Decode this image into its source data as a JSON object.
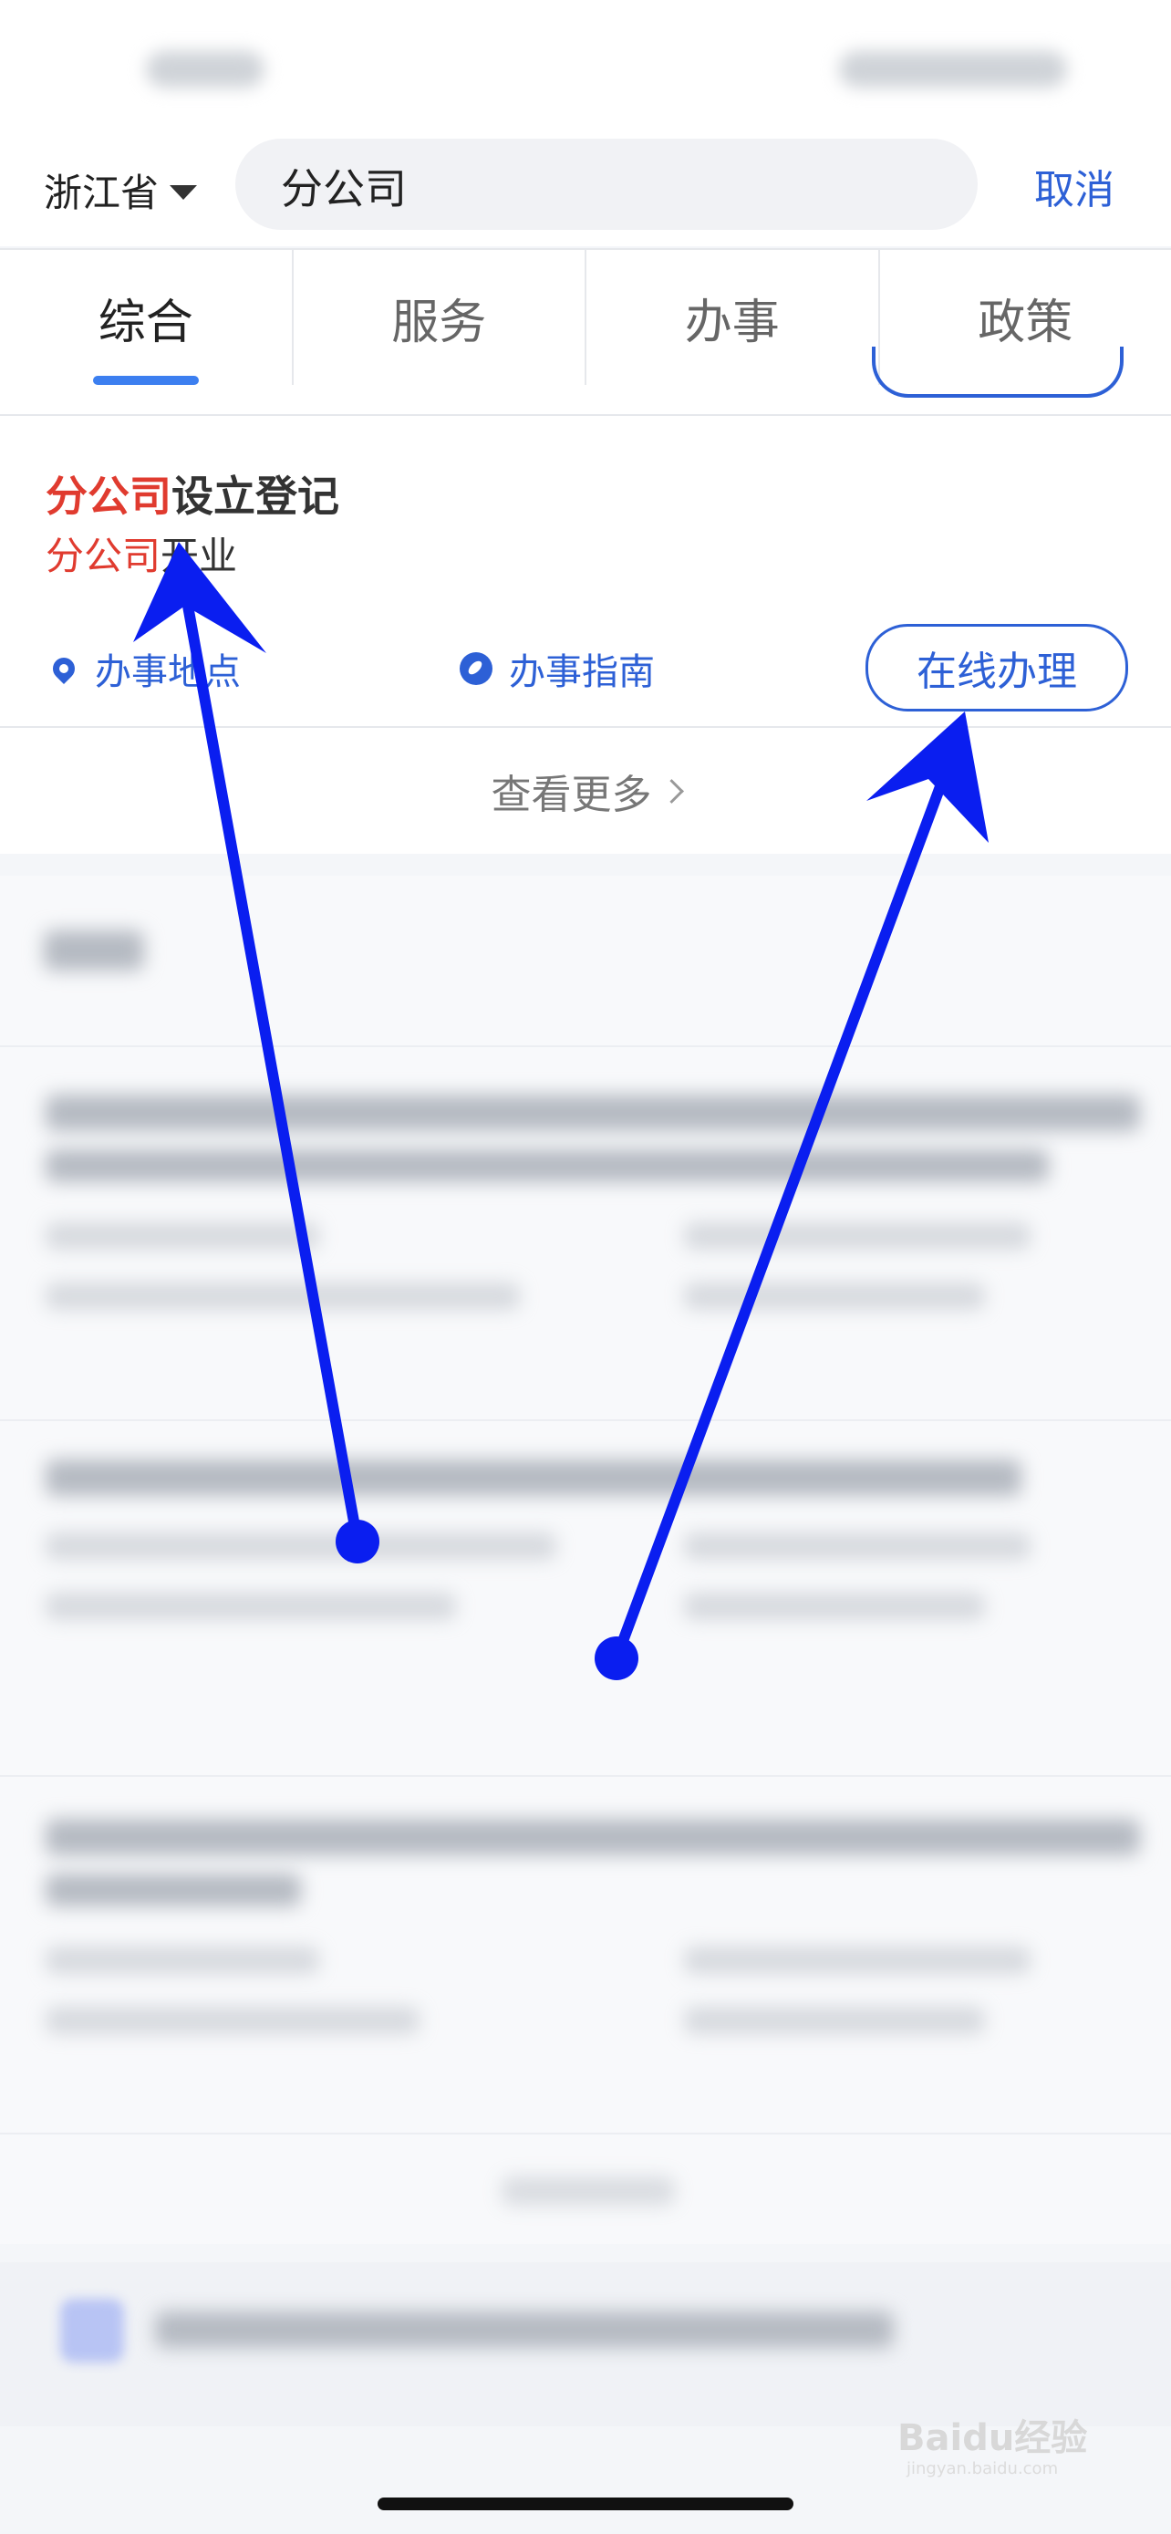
{
  "header": {
    "province": "浙江省",
    "search_value": "分公司",
    "cancel_label": "取消"
  },
  "tabs": [
    {
      "label": "综合",
      "active": true
    },
    {
      "label": "服务",
      "active": false
    },
    {
      "label": "办事",
      "active": false
    },
    {
      "label": "政策",
      "active": false
    }
  ],
  "result": {
    "title_highlight": "分公司",
    "title_rest": "设立登记",
    "subtitle_highlight": "分公司",
    "subtitle_rest": "开业",
    "location_label": "办事地点",
    "guide_label": "办事指南",
    "online_button": "在线办理"
  },
  "more_label": "查看更多",
  "watermark": {
    "text": "Baidu经验",
    "url": "jingyan.baidu.com"
  },
  "colors": {
    "accent": "#2d60d6",
    "highlight": "#e03b2f",
    "tab_indicator": "#3c7ff0",
    "annotation_arrow": "#0a1ef0"
  }
}
